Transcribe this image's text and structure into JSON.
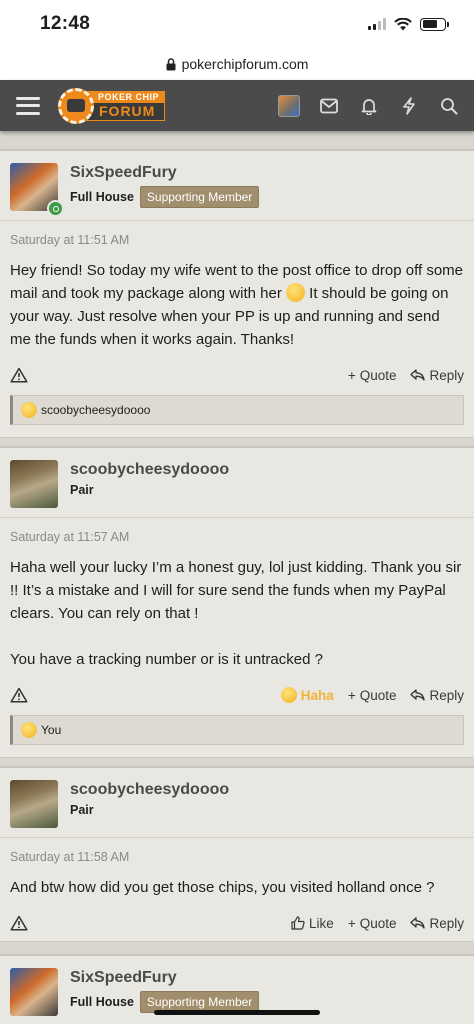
{
  "status_bar": {
    "time": "12:48"
  },
  "browser": {
    "url": "pokerchipforum.com"
  },
  "site": {
    "logo_top": "POKER CHIP",
    "logo_bottom": "FORUM"
  },
  "posts": [
    {
      "username": "SixSpeedFury",
      "user_title": "Full House",
      "badge": "Supporting Member",
      "date": "Saturday at 11:51 AM",
      "body_part1": "Hey friend! So today my wife went to the post office to drop off some mail and took my package along with her ",
      "body_part2": " It should be going on your way. Just resolve when your PP is up and running and send me the funds when it works again. Thanks!",
      "actions": {
        "quote": "Quote",
        "reply": "Reply"
      },
      "reactions": "scoobycheesydoooo"
    },
    {
      "username": "scoobycheesydoooo",
      "user_title": "Pair",
      "date": "Saturday at 11:57 AM",
      "body_p1": "Haha well your lucky I’m a honest guy, lol just kidding. Thank you sir !! It’s a mistake and I will for sure send the funds when my PayPal clears. You can rely on that !",
      "body_p2": "You have a tracking number or is it untracked ?",
      "actions": {
        "haha": "Haha",
        "quote": "Quote",
        "reply": "Reply"
      },
      "reactions": "You"
    },
    {
      "username": "scoobycheesydoooo",
      "user_title": "Pair",
      "date": "Saturday at 11:58 AM",
      "body": "And btw how did you get those chips, you visited holland once ?",
      "actions": {
        "like": "Like",
        "quote": "Quote",
        "reply": "Reply"
      }
    },
    {
      "username": "SixSpeedFury",
      "user_title": "Full House",
      "badge": "Supporting Member"
    }
  ],
  "colors": {
    "navbar": "#4b4b4b",
    "accent_orange": "#ee8a1b",
    "badge": "#a18e6c",
    "haha": "#f0b338"
  }
}
